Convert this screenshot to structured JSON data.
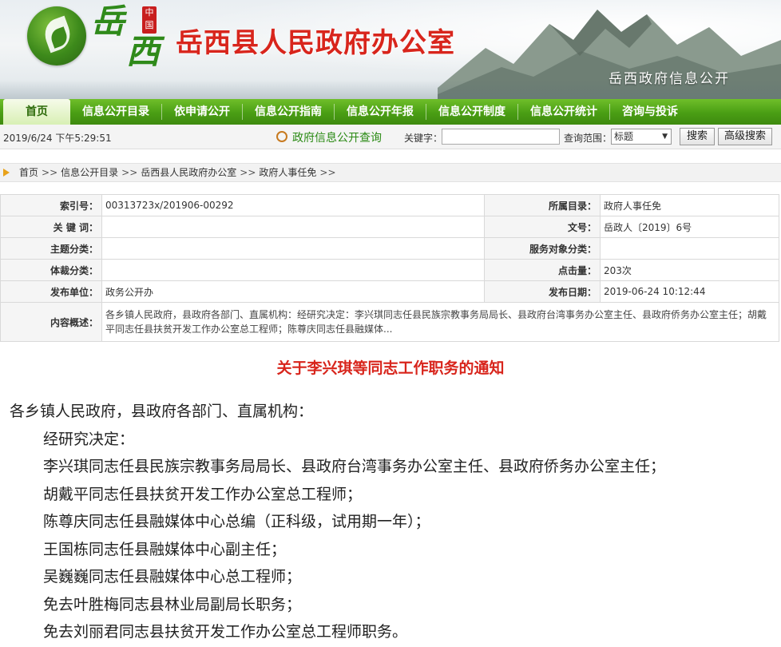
{
  "header": {
    "logo_char_1": "岳",
    "logo_char_2": "西",
    "seal_text": "中国",
    "site_title": "岳西县人民政府办公室",
    "site_subtitle": "岳西政府信息公开"
  },
  "nav": {
    "items": [
      "首页",
      "信息公开目录",
      "依申请公开",
      "信息公开指南",
      "信息公开年报",
      "信息公开制度",
      "信息公开统计",
      "咨询与投诉"
    ]
  },
  "toolbar": {
    "date": "2019/6/24 下午5:29:51",
    "query_title": "政府信息公开查询",
    "keyword_label": "关键字：",
    "keyword_value": "",
    "scope_label": "查询范围：",
    "scope_selected": "标题",
    "search_button": "搜索",
    "advanced_button": "高级搜索"
  },
  "breadcrumb": {
    "items": [
      "首页",
      "信息公开目录",
      "岳西县人民政府办公室",
      "政府人事任免"
    ],
    "separator": ">>"
  },
  "meta": {
    "index_label": "索引号：",
    "index_value": "00313723x/201906-00292",
    "catalog_label": "所属目录：",
    "catalog_value": "政府人事任免",
    "keywords_label": "关 键 词：",
    "keywords_value": "",
    "docno_label": "文号：",
    "docno_value": "岳政人〔2019〕6号",
    "topic_label": "主题分类：",
    "topic_value": "",
    "audience_label": "服务对象分类：",
    "audience_value": "",
    "genre_label": "体裁分类：",
    "genre_value": "",
    "clicks_label": "点击量：",
    "clicks_value": "203次",
    "publisher_label": "发布单位：",
    "publisher_value": "政务公开办",
    "date_label": "发布日期：",
    "date_value": "2019-06-24 10:12:44",
    "summary_label": "内容概述：",
    "summary_value": "各乡镇人民政府，县政府各部门、直属机构：经研究决定：李兴琪同志任县民族宗教事务局局长、县政府台湾事务办公室主任、县政府侨务办公室主任；胡戴平同志任县扶贫开发工作办公室总工程师；陈尊庆同志任县融媒体..."
  },
  "article": {
    "title": "关于李兴琪等同志工作职务的通知",
    "paragraphs": [
      "各乡镇人民政府，县政府各部门、直属机构：",
      "经研究决定：",
      "李兴琪同志任县民族宗教事务局局长、县政府台湾事务办公室主任、县政府侨务办公室主任；",
      "胡戴平同志任县扶贫开发工作办公室总工程师；",
      "陈尊庆同志任县融媒体中心总编（正科级，试用期一年）；",
      "王国栋同志任县融媒体中心副主任；",
      "吴巍巍同志任县融媒体中心总工程师；",
      "免去叶胜梅同志县林业局副局长职务；",
      "免去刘丽君同志县扶贫开发工作办公室总工程师职务。"
    ]
  },
  "colors": {
    "nav_green": "#4a9e14",
    "title_red": "#d8251c",
    "link_green": "#2a8a14"
  }
}
